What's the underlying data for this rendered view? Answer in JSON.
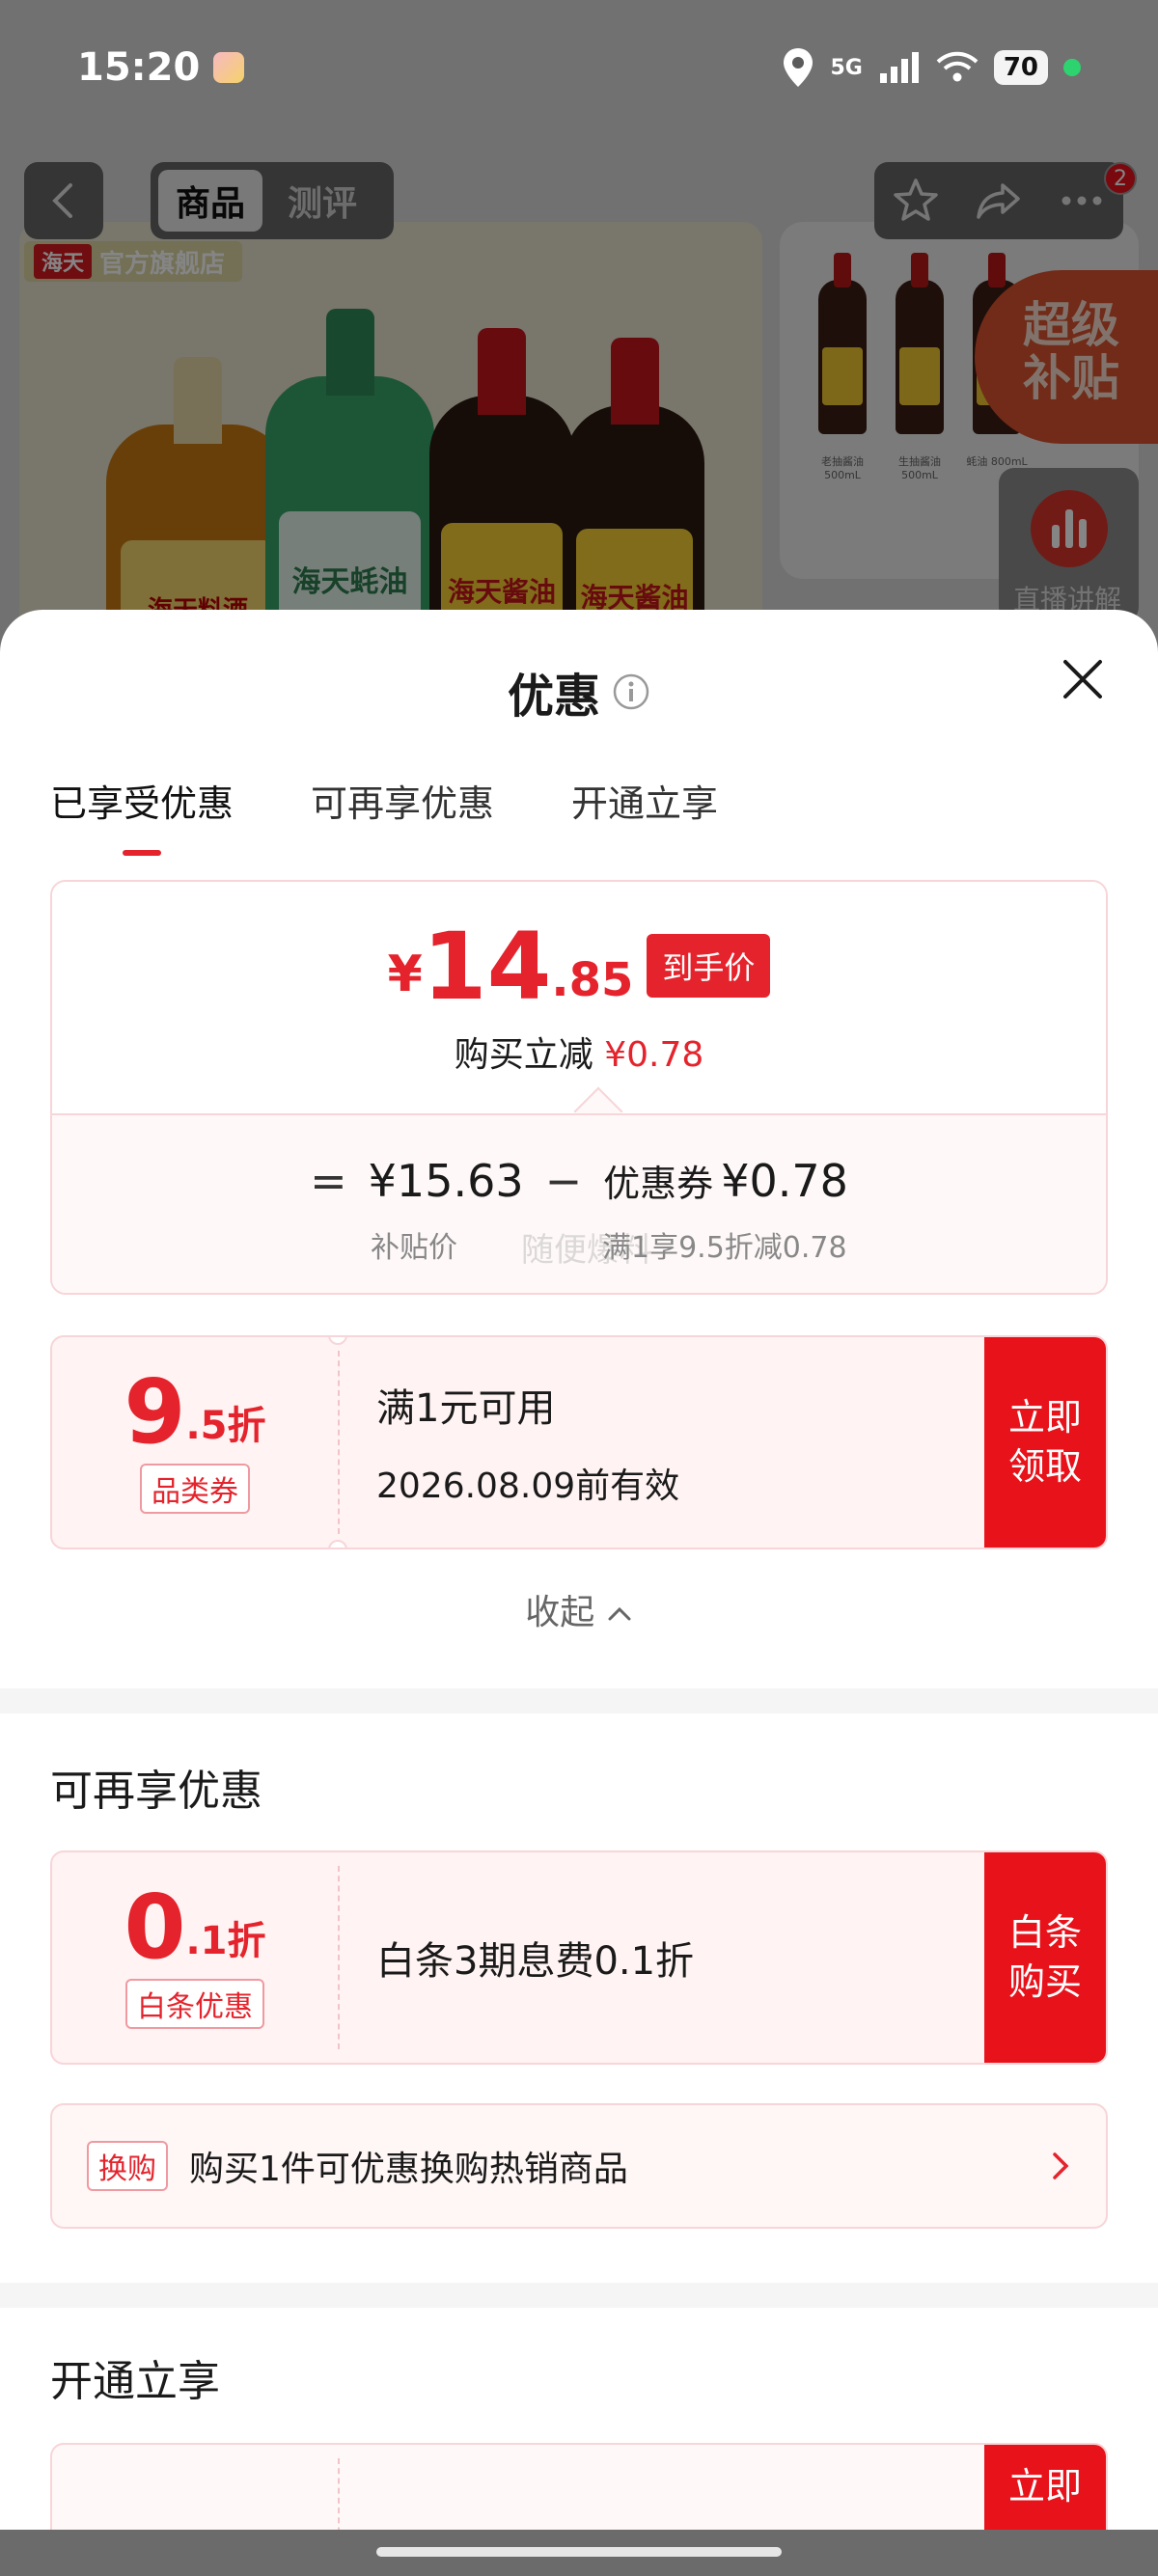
{
  "status_bar": {
    "time": "15:20",
    "network": "5G",
    "battery": "70"
  },
  "background": {
    "tabs": [
      {
        "label": "商品"
      },
      {
        "label": "测评"
      }
    ],
    "store_brand": "海天",
    "store_name": "官方旗舰店",
    "bottle_labels": [
      "海天料酒",
      "海天蚝油",
      "海天酱油",
      "海天酱油"
    ],
    "side_captions": [
      "老抽酱油 500mL",
      "生抽酱油 500mL",
      "蚝油 800mL"
    ],
    "notification_count": "2",
    "super_subsidy": "超级补贴",
    "live_label": "直播讲解"
  },
  "sheet": {
    "title": "优惠",
    "tabs": [
      {
        "label": "已享受优惠",
        "active": true
      },
      {
        "label": "可再享优惠",
        "active": false
      },
      {
        "label": "开通立享",
        "active": false
      }
    ],
    "price": {
      "currency": "¥",
      "integer": "14",
      "decimal": ".85",
      "tag": "到手价",
      "instant_label": "购买立减",
      "instant_value": "¥0.78"
    },
    "formula": {
      "equals": "=",
      "base": "¥15.63",
      "minus": "−",
      "coupon_label": "优惠券",
      "coupon_value": "¥0.78",
      "base_caption": "补贴价",
      "coupon_caption": "满1享9.5折减0.78",
      "watermark": "随便爆料"
    },
    "coupon_enjoyed": {
      "big": "9",
      "small": ".5折",
      "tag": "品类券",
      "line1": "满1元可用",
      "line2": "2026.08.09前有效",
      "button": "立即领取"
    },
    "collapse_label": "收起",
    "section_more": {
      "title": "可再享优惠",
      "coupon": {
        "big": "0",
        "small": ".1折",
        "tag": "白条优惠",
        "line1": "白条3期息费0.1折",
        "button": "白条购买"
      },
      "exchange": {
        "tag": "换购",
        "text": "购买1件可优惠换购热销商品"
      }
    },
    "section_open": {
      "title": "开通立享",
      "button": "立即"
    }
  },
  "colors": {
    "accent": "#e4232c",
    "button_red": "#e8121b",
    "card_bg": "#fff3f3",
    "card_border": "#f7d5d8"
  }
}
